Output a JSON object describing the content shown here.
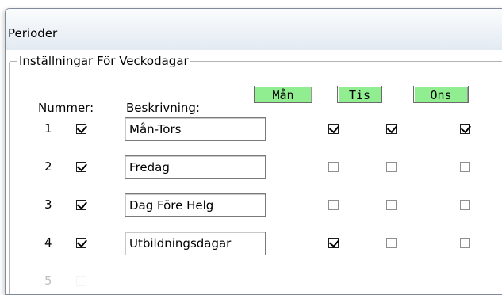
{
  "window": {
    "title": "Perioder"
  },
  "group": {
    "legend": "Inställningar För Veckodagar"
  },
  "headers": {
    "number": "Nummer:",
    "description": "Beskrivning:"
  },
  "days": [
    {
      "label": "Mån",
      "color": "#90ee90"
    },
    {
      "label": "Tis",
      "color": "#90ee90"
    },
    {
      "label": "Ons",
      "color": "#90ee90"
    }
  ],
  "rows": [
    {
      "number": "1",
      "enabled": true,
      "description": "Mån-Tors",
      "days": [
        true,
        true,
        true
      ]
    },
    {
      "number": "2",
      "enabled": true,
      "description": "Fredag",
      "days": [
        false,
        false,
        false
      ]
    },
    {
      "number": "3",
      "enabled": true,
      "description": "Dag Före Helg",
      "days": [
        false,
        false,
        false
      ]
    },
    {
      "number": "4",
      "enabled": true,
      "description": "Utbildningsdagar",
      "days": [
        true,
        false,
        false
      ]
    },
    {
      "number": "5",
      "enabled": false,
      "description": "",
      "days": []
    }
  ]
}
